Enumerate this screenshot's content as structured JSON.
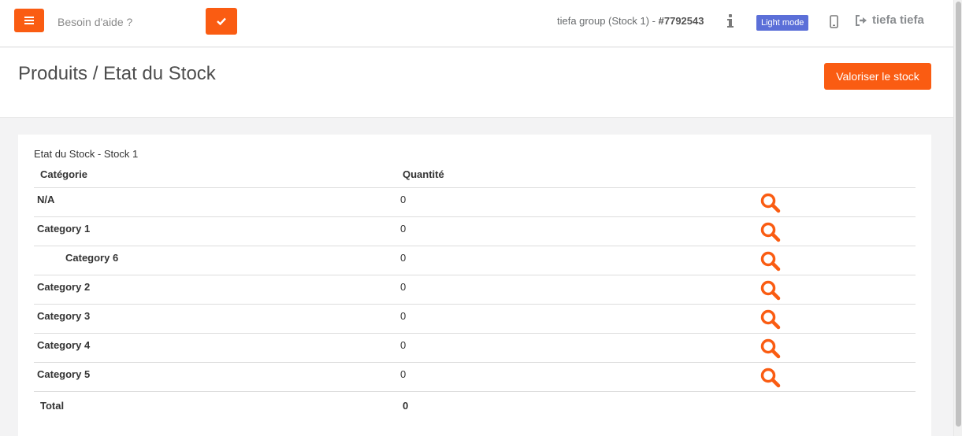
{
  "topbar": {
    "search_placeholder": "Besoin d'aide ?",
    "account_prefix": "tiefa group (Stock 1) - ",
    "account_id": "#7792543",
    "light_mode_label": "Light mode",
    "user_name": "tiefa tiefa",
    "icons": [
      "hamburger-icon",
      "check-icon",
      "info-icon",
      "mobile-icon",
      "sign-out-icon"
    ],
    "accent_color": "#fa5c12",
    "badge_color": "#5b6fd8"
  },
  "header": {
    "title": "Produits / Etat du Stock",
    "valoriser_label": "Valoriser le stock"
  },
  "stock": {
    "panel_title": "Etat du Stock - Stock 1",
    "columns": [
      "Catégorie",
      "Quantité"
    ],
    "rows": [
      {
        "category": "N/A",
        "quantity": "0",
        "indent": false
      },
      {
        "category": "Category 1",
        "quantity": "0",
        "indent": false
      },
      {
        "category": "Category 6",
        "quantity": "0",
        "indent": true
      },
      {
        "category": "Category 2",
        "quantity": "0",
        "indent": false
      },
      {
        "category": "Category 3",
        "quantity": "0",
        "indent": false
      },
      {
        "category": "Category 4",
        "quantity": "0",
        "indent": false
      },
      {
        "category": "Category 5",
        "quantity": "0",
        "indent": false
      }
    ],
    "total_label": "Total",
    "total_quantity": "0"
  }
}
